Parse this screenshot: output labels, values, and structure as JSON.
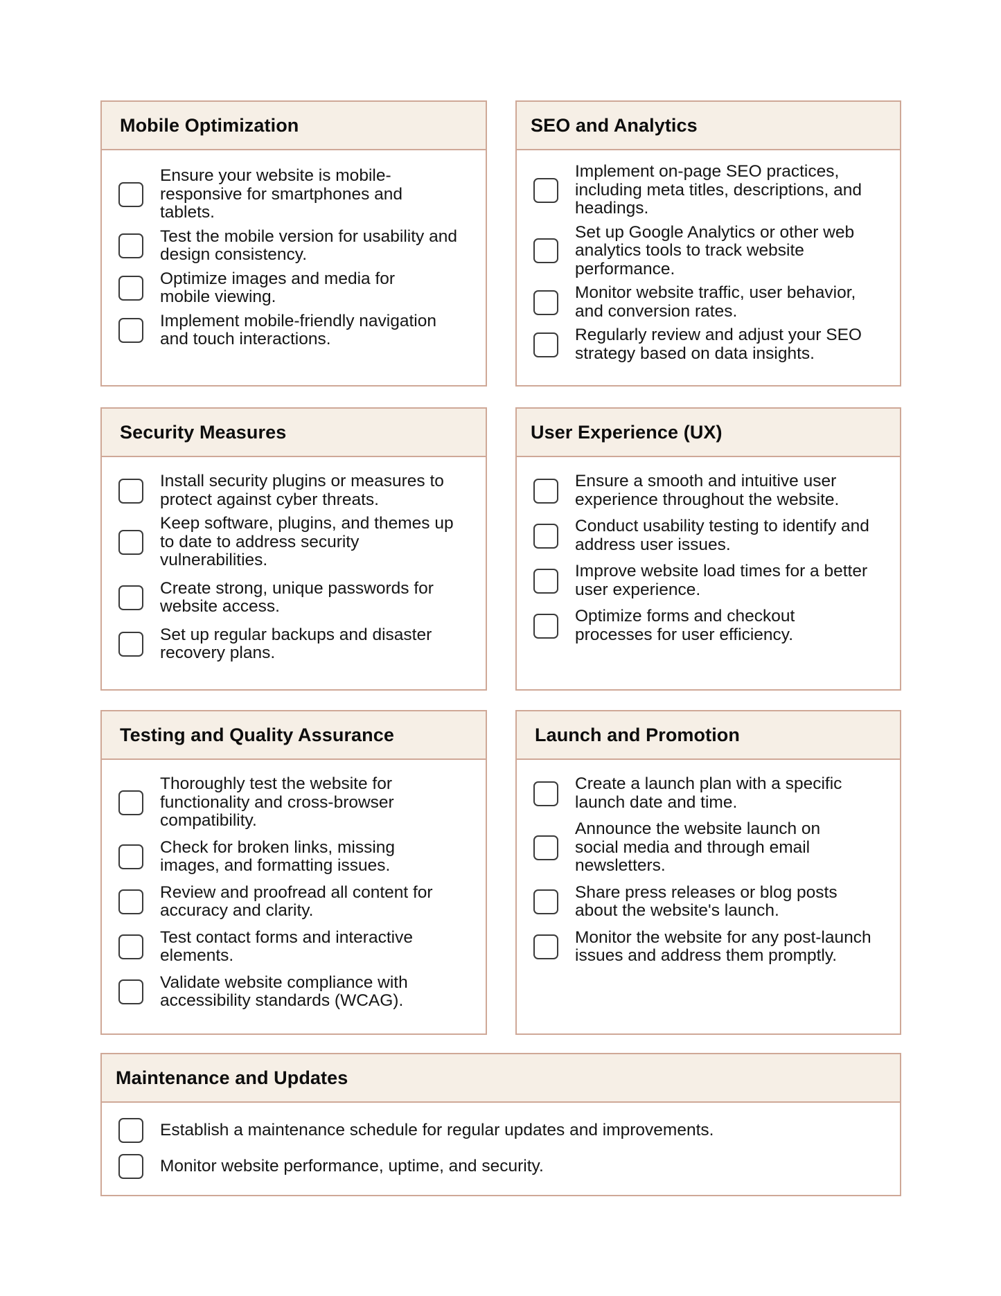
{
  "sections": [
    {
      "title": "Mobile Optimization",
      "items": [
        "Ensure your website is mobile-responsive for smartphones and tablets.",
        "Test the mobile version for usability and design consistency.",
        "Optimize images and media for mobile viewing.",
        "Implement mobile-friendly navigation and touch interactions."
      ]
    },
    {
      "title": "SEO and Analytics",
      "items": [
        "Implement on-page SEO practices, including meta titles, descriptions, and headings.",
        "Set up Google Analytics or other web analytics tools to track website performance.",
        "Monitor website traffic, user behavior, and conversion rates.",
        "Regularly review and adjust your SEO strategy based on data insights."
      ]
    },
    {
      "title": "Security Measures",
      "items": [
        "Install security plugins or measures to protect against cyber threats.",
        "Keep software, plugins, and themes up to date to address security vulnerabilities.",
        "Create strong, unique passwords for website access.",
        "Set up regular backups and disaster recovery plans."
      ]
    },
    {
      "title": "User Experience (UX)",
      "items": [
        "Ensure a smooth and intuitive user experience throughout the website.",
        "Conduct usability testing to identify and address user issues.",
        "Improve website load times for a better user experience.",
        "Optimize forms and checkout processes for user efficiency."
      ]
    },
    {
      "title": "Testing and Quality Assurance",
      "items": [
        "Thoroughly test the website for functionality and cross-browser compatibility.",
        "Check for broken links, missing images, and formatting issues.",
        "Review and proofread all content for accuracy and clarity.",
        "Test contact forms and interactive elements.",
        "Validate website compliance with accessibility standards (WCAG)."
      ]
    },
    {
      "title": "Launch and Promotion",
      "items": [
        "Create a launch plan with a specific launch date and time.",
        "Announce the website launch on social media and through email newsletters.",
        "Share press releases or blog posts about the website's launch.",
        "Monitor the website for any post-launch issues and address them promptly."
      ]
    },
    {
      "title": "Maintenance and Updates",
      "items": [
        "Establish a maintenance schedule for regular updates and improvements.",
        "Monitor website performance, uptime, and security."
      ]
    }
  ]
}
